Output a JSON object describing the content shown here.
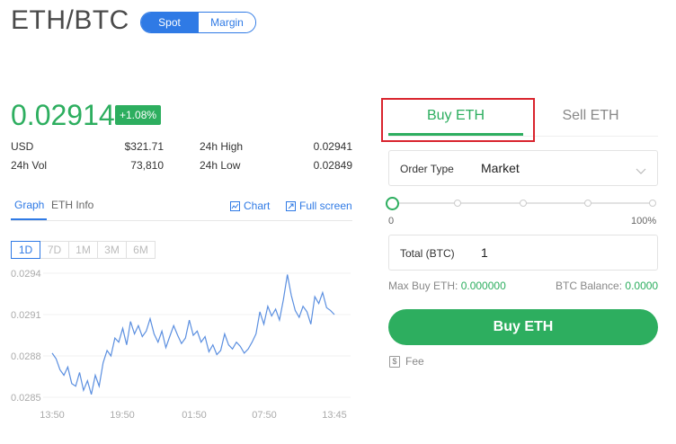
{
  "pair": {
    "title": "ETH/BTC"
  },
  "mode_toggle": {
    "spot": "Spot",
    "margin": "Margin"
  },
  "ticker": {
    "price": "0.02914",
    "change": "+1.08%",
    "usd_label": "USD",
    "usd_value": "$321.71",
    "high_label": "24h High",
    "high_value": "0.02941",
    "vol_label": "24h Vol",
    "vol_value": "73,810",
    "low_label": "24h Low",
    "low_value": "0.02849"
  },
  "graph_tabs": {
    "graph": "Graph",
    "info": "ETH Info",
    "chart_link": "Chart",
    "fullscreen_link": "Full screen"
  },
  "ranges": [
    "1D",
    "7D",
    "1M",
    "3M",
    "6M"
  ],
  "active_range": "1D",
  "chart_data": {
    "type": "line",
    "y_ticks": [
      "0.0294",
      "0.0291",
      "0.0288",
      "0.0285"
    ],
    "x_ticks": [
      "13:50",
      "19:50",
      "01:50",
      "07:50",
      "13:45"
    ],
    "ylim": [
      0.0285,
      0.0294
    ],
    "color": "#5b8fe0",
    "series": [
      {
        "values": [
          0.02882,
          0.02878,
          0.0287,
          0.02866,
          0.02872,
          0.0286,
          0.02858,
          0.02868,
          0.02855,
          0.02862,
          0.02852,
          0.02866,
          0.02858,
          0.02875,
          0.02884,
          0.0288,
          0.02893,
          0.0289,
          0.029,
          0.02888,
          0.02905,
          0.02896,
          0.02902,
          0.02894,
          0.02898,
          0.02907,
          0.02896,
          0.0289,
          0.02898,
          0.02886,
          0.02894,
          0.02902,
          0.02895,
          0.02889,
          0.02893,
          0.02906,
          0.02895,
          0.02898,
          0.0289,
          0.02894,
          0.02883,
          0.02888,
          0.02881,
          0.02884,
          0.02896,
          0.02888,
          0.02885,
          0.0289,
          0.02887,
          0.02882,
          0.02885,
          0.0289,
          0.02896,
          0.02912,
          0.02903,
          0.02916,
          0.02909,
          0.02914,
          0.02906,
          0.02921,
          0.02939,
          0.02924,
          0.02913,
          0.02908,
          0.02916,
          0.02912,
          0.02903,
          0.02923,
          0.02918,
          0.02926,
          0.02915,
          0.02913,
          0.0291
        ]
      }
    ]
  },
  "trade": {
    "buy_tab": "Buy ETH",
    "sell_tab": "Sell ETH",
    "order_type_label": "Order Type",
    "order_type_value": "Market",
    "slider_min": "0",
    "slider_max": "100%",
    "slider_value": 0,
    "total_label": "Total (BTC)",
    "total_value": "1",
    "max_buy_label": "Max Buy ETH:",
    "max_buy_value": "0.000000",
    "balance_label": "BTC Balance:",
    "balance_value": "0.0000",
    "buy_button": "Buy ETH",
    "fee_label": "Fee"
  },
  "colors": {
    "accent": "#2f7ae5",
    "positive": "#2dae5f",
    "highlight": "#d9242e"
  }
}
